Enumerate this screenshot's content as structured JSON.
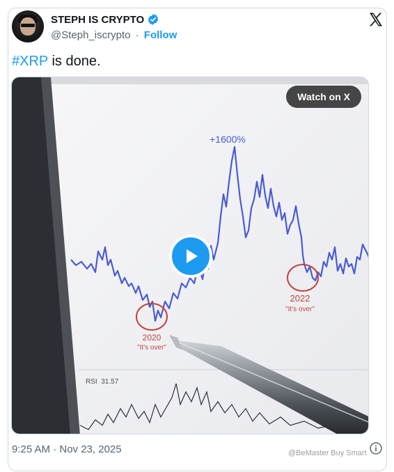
{
  "author": {
    "display_name": "STEPH IS CRYPTO",
    "handle": "@Steph_iscrypto",
    "separator": "·",
    "follow_label": "Follow"
  },
  "tweet": {
    "hashtag": "#XRP",
    "text_rest": " is done.",
    "timestamp": "9:25 AM · Nov 23, 2025"
  },
  "media": {
    "watch_label": "Watch on X",
    "chart_annotations": {
      "peak": "+1600%",
      "left_year": "2020",
      "left_note": "\"It's over\"",
      "right_year": "2022",
      "right_note": "\"It's over\"",
      "rsi_label": "RSI  31.57"
    }
  },
  "watermark": "@BeMaster Buy Smart",
  "colors": {
    "accent": "#1d9bf0",
    "line": "#4a5bd4",
    "circle": "#c0453b"
  },
  "icons": [
    "verified-badge-icon",
    "x-logo-icon",
    "play-icon",
    "info-icon"
  ]
}
